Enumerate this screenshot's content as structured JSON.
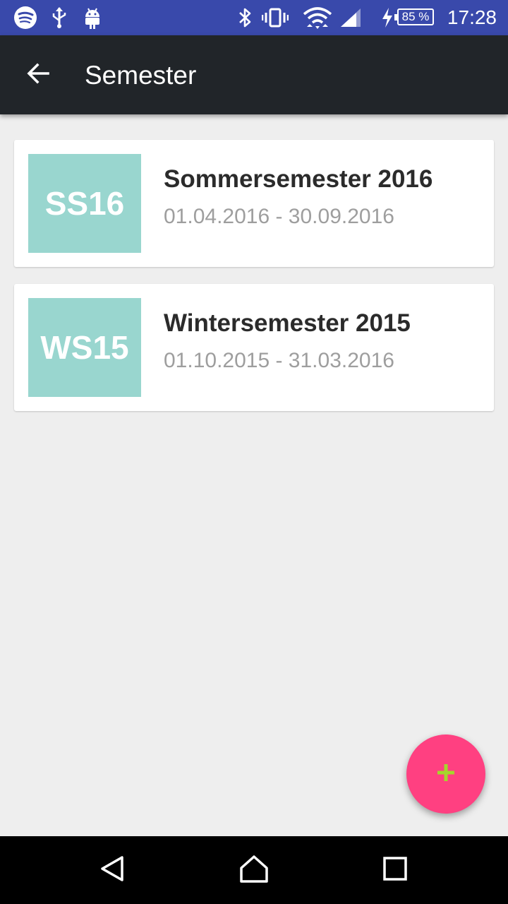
{
  "status_bar": {
    "time": "17:28",
    "battery": "85 %",
    "icons": [
      "spotify-icon",
      "usb-icon",
      "android-icon",
      "bluetooth-icon",
      "vibrate-icon",
      "wifi-icon",
      "signal-icon",
      "charging-icon"
    ]
  },
  "app_bar": {
    "title": "Semester",
    "back_icon": "arrow-back-icon"
  },
  "semesters": [
    {
      "badge": "SS16",
      "title": "Sommersemester 2016",
      "dates": "01.04.2016 - 30.09.2016"
    },
    {
      "badge": "WS15",
      "title": "Wintersemester 2015",
      "dates": "01.10.2015 - 31.03.2016"
    }
  ],
  "fab": {
    "icon": "plus-icon"
  },
  "nav_bar": {
    "icons": [
      "back-triangle-icon",
      "home-icon",
      "recents-icon"
    ]
  },
  "colors": {
    "status_bar": "#3949ab",
    "app_bar": "#212529",
    "badge": "#99d6cf",
    "fab": "#ff4081",
    "fab_icon": "#a5d62c",
    "background": "#eeeeee"
  }
}
